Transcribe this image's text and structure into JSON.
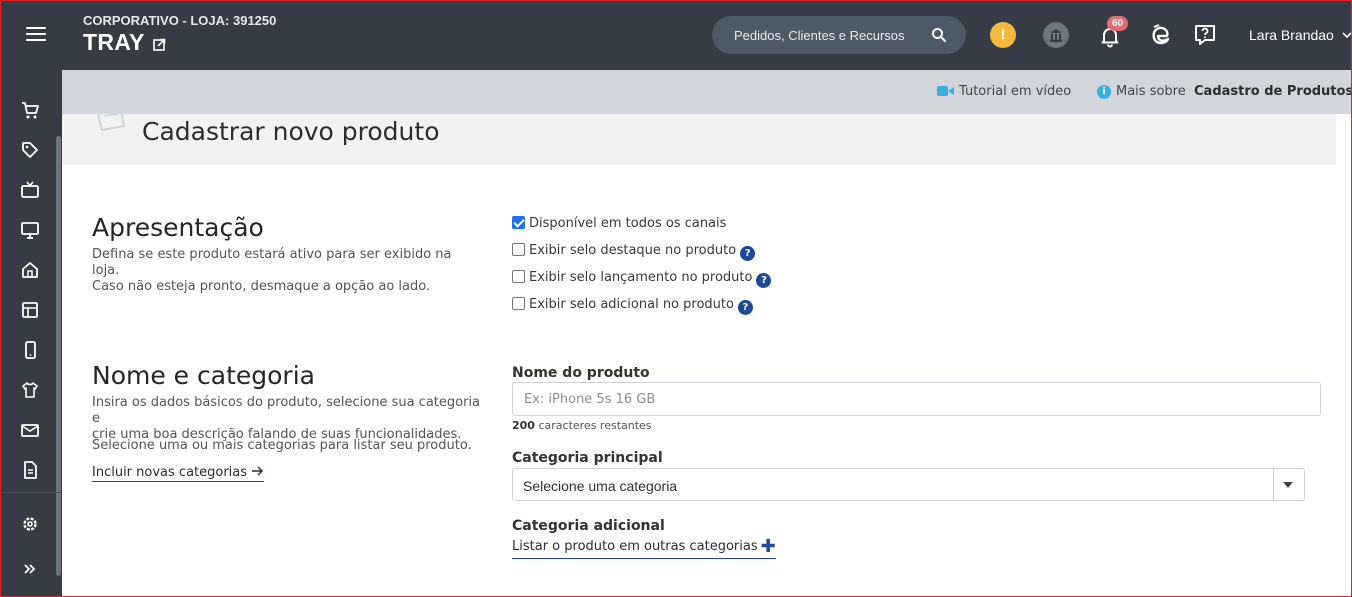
{
  "header": {
    "store_line": "CORPORATIVO - LOJA: 391250",
    "store_name": "TRAY",
    "search_placeholder": "Pedidos, Clientes e Recursos",
    "alert_glyph": "!",
    "notifications_count": "60",
    "user_name": "Lara Brandao",
    "icons": [
      "menu-icon",
      "external-link-icon",
      "search-icon",
      "alert-icon",
      "bank-icon",
      "bell-icon",
      "edge-app-icon",
      "help-chat-icon",
      "chevron-down-icon"
    ],
    "colors": {
      "bar": "#353c45",
      "search_bg": "#4e5966",
      "alert": "#f6b93b",
      "badge": "#e46a76"
    }
  },
  "sidebar": {
    "items": [
      "cart-icon",
      "tag-icon",
      "tv-icon",
      "monitor-icon",
      "store-icon",
      "layout-icon",
      "mobile-icon",
      "shirt-icon",
      "mail-icon",
      "document-icon",
      "settings-icon",
      "expand-icon"
    ]
  },
  "infobar": {
    "tutorial_label": "Tutorial em vídeo",
    "more_prefix": "Mais sobre",
    "more_topic": "Cadastro de Produtos"
  },
  "page": {
    "title": "Cadastrar novo produto"
  },
  "apresentacao": {
    "title": "Apresentação",
    "desc_line1": "Defina se este produto estará ativo para ser exibido na loja.",
    "desc_line2": "Caso não esteja pronto, desmaque a opção ao lado.",
    "options": [
      {
        "label": "Disponível em todos os canais",
        "checked": true
      },
      {
        "label": "Exibir selo destaque no produto",
        "checked": false
      },
      {
        "label": "Exibir selo lançamento no produto",
        "checked": false
      },
      {
        "label": "Exibir selo adicional no produto",
        "checked": false
      }
    ]
  },
  "nome_categoria": {
    "title": "Nome e categoria",
    "desc_line1": "Insira os dados básicos do produto, selecione sua categoria e",
    "desc_line2": "crie uma boa descrição falando de suas funcionalidades.",
    "desc2": "Selecione uma ou mais categorias para listar seu produto.",
    "link_label": "Incluir novas categorias",
    "product_name_label": "Nome do produto",
    "product_name_placeholder": "Ex: iPhone 5s 16 GB",
    "product_name_value": "",
    "chars_count": "200",
    "chars_suffix": "caracteres restantes",
    "main_category_label": "Categoria principal",
    "main_category_value": "Selecione uma categoria",
    "extra_category_label": "Categoria adicional",
    "extra_category_link": "Listar o produto em outras categorias"
  }
}
